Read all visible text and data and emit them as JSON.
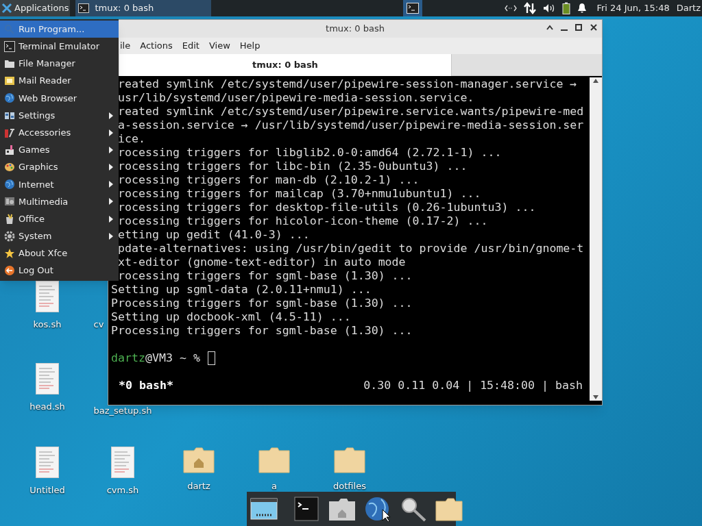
{
  "panel": {
    "applications_label": "Applications",
    "tasks": [
      {
        "label": "tmux: 0 bash",
        "selected": true
      }
    ],
    "clock": "Fri 24 Jun, 15:48",
    "user": "Dartz"
  },
  "app_menu": {
    "items": [
      {
        "label": "Run Program...",
        "kind": "search",
        "submenu": false,
        "selected": true
      },
      {
        "label": "Terminal Emulator",
        "kind": "terminal",
        "submenu": false,
        "selected": false
      },
      {
        "label": "File Manager",
        "kind": "folder",
        "submenu": false,
        "selected": false
      },
      {
        "label": "Mail Reader",
        "kind": "mail",
        "submenu": false,
        "selected": false
      },
      {
        "label": "Web Browser",
        "kind": "globe",
        "submenu": false,
        "selected": false
      },
      {
        "label": "Settings",
        "kind": "settings",
        "submenu": true,
        "selected": false
      },
      {
        "label": "Accessories",
        "kind": "tools",
        "submenu": true,
        "selected": false
      },
      {
        "label": "Games",
        "kind": "games",
        "submenu": true,
        "selected": false
      },
      {
        "label": "Graphics",
        "kind": "palette",
        "submenu": true,
        "selected": false
      },
      {
        "label": "Internet",
        "kind": "globe",
        "submenu": true,
        "selected": false
      },
      {
        "label": "Multimedia",
        "kind": "media",
        "submenu": true,
        "selected": false
      },
      {
        "label": "Office",
        "kind": "office",
        "submenu": true,
        "selected": false
      },
      {
        "label": "System",
        "kind": "gear",
        "submenu": true,
        "selected": false
      },
      {
        "label": "About Xfce",
        "kind": "star",
        "submenu": false,
        "selected": false
      },
      {
        "label": "Log Out",
        "kind": "logout",
        "submenu": false,
        "selected": false
      }
    ]
  },
  "terminal_window": {
    "title": "tmux: 0 bash",
    "menu": [
      "ile",
      "Actions",
      "Edit",
      "View",
      "Help"
    ],
    "tab": "tmux: 0 bash",
    "lines": [
      {
        "kind": "covered",
        "text": "reated symlink /etc/systemd/user/pipewire-session-manager.service →"
      },
      {
        "kind": "covered",
        "text": "usr/lib/systemd/user/pipewire-media-session.service."
      },
      {
        "kind": "covered",
        "text": "reated symlink /etc/systemd/user/pipewire.service.wants/pipewire-med"
      },
      {
        "kind": "covered",
        "text": "a-session.service → /usr/lib/systemd/user/pipewire-media-session.ser"
      },
      {
        "kind": "covered",
        "text": "ice."
      },
      {
        "kind": "covered",
        "text": "rocessing triggers for libglib2.0-0:amd64 (2.72.1-1) ..."
      },
      {
        "kind": "covered",
        "text": "rocessing triggers for libc-bin (2.35-0ubuntu3) ..."
      },
      {
        "kind": "covered",
        "text": "rocessing triggers for man-db (2.10.2-1) ..."
      },
      {
        "kind": "covered",
        "text": "rocessing triggers for mailcap (3.70+nmu1ubuntu1) ..."
      },
      {
        "kind": "covered",
        "text": "rocessing triggers for desktop-file-utils (0.26-1ubuntu3) ..."
      },
      {
        "kind": "covered",
        "text": "rocessing triggers for hicolor-icon-theme (0.17-2) ..."
      },
      {
        "kind": "covered",
        "text": "etting up gedit (41.0-3) ..."
      },
      {
        "kind": "covered",
        "text": "pdate-alternatives: using /usr/bin/gedit to provide /usr/bin/gnome-t"
      },
      {
        "kind": "covered",
        "text": "xt-editor (gnome-text-editor) in auto mode"
      },
      {
        "kind": "covered",
        "text": "rocessing triggers for sgml-base (1.30) ..."
      },
      {
        "kind": "full",
        "text": "Setting up sgml-data (2.0.11+nmu1) ..."
      },
      {
        "kind": "full",
        "text": "Processing triggers for sgml-base (1.30) ..."
      },
      {
        "kind": "full",
        "text": "Setting up docbook-xml (4.5-11) ..."
      },
      {
        "kind": "full",
        "text": "Processing triggers for sgml-base (1.30) ..."
      }
    ],
    "prompt_user": "dartz",
    "prompt_rest": "@VM3 ~ %",
    "status_left": "*0 bash*",
    "status_right": "0.30 0.11 0.04 | 15:48:00 | bash"
  },
  "desktop_icons": [
    {
      "label": "kos.sh",
      "kind": "document"
    },
    {
      "label": "cv",
      "kind": "covered"
    },
    {
      "label": "head.sh",
      "kind": "document"
    },
    {
      "label": "baz_setup.sh",
      "kind": "covered"
    },
    {
      "label": "Untitled",
      "kind": "document"
    },
    {
      "label": "cvm.sh",
      "kind": "document"
    },
    {
      "label": "dartz",
      "kind": "home"
    },
    {
      "label": "a",
      "kind": "folder"
    },
    {
      "label": "dotfiles",
      "kind": "folder"
    }
  ]
}
